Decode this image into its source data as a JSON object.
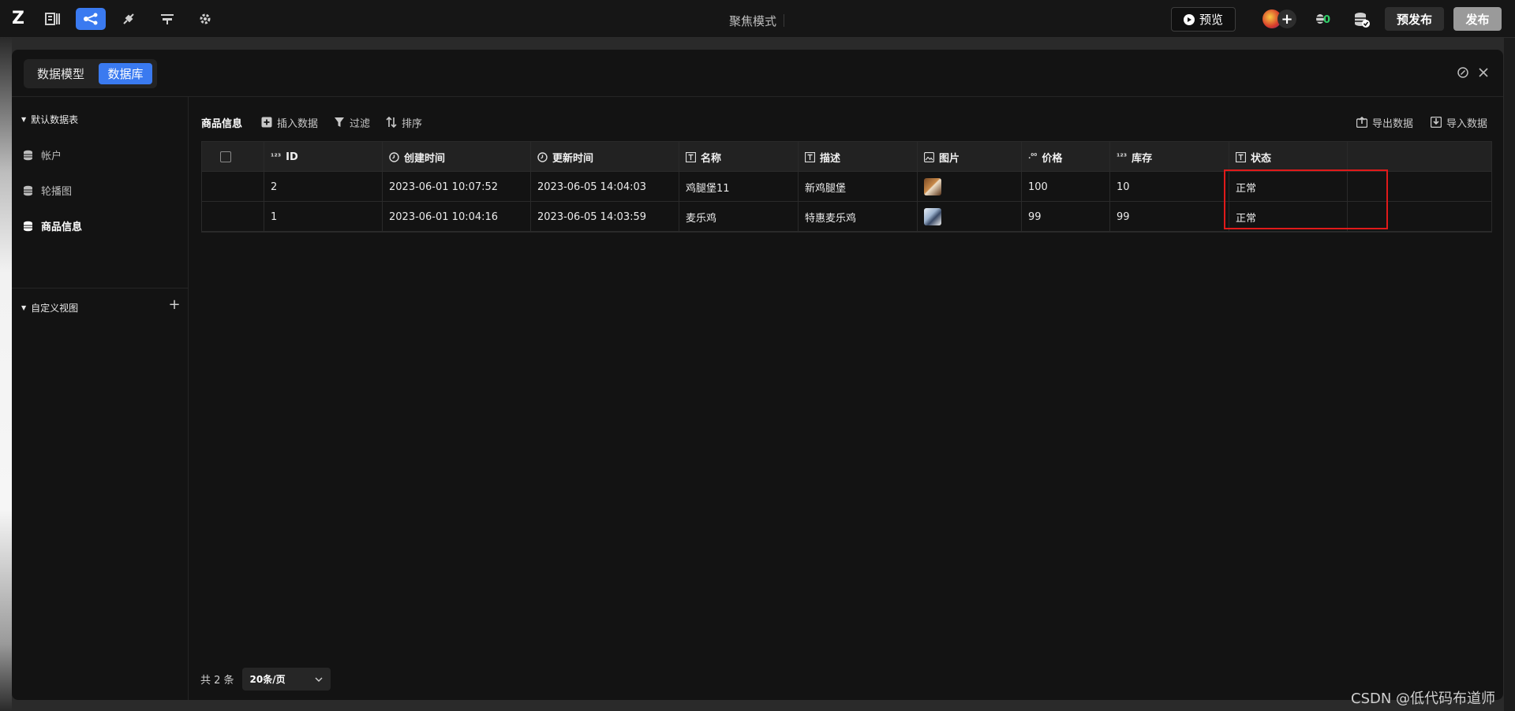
{
  "toolbar": {
    "logo": "Z",
    "focus_mode": "聚焦模式",
    "preview_label": "预览",
    "prepublish_label": "预发布",
    "publish_label": "发布",
    "bug_count": "0"
  },
  "panel": {
    "tabs": [
      {
        "label": "数据模型",
        "active": false
      },
      {
        "label": "数据库",
        "active": true
      }
    ]
  },
  "sidebar": {
    "group_default": "默认数据表",
    "items": [
      {
        "label": "帐户",
        "active": false
      },
      {
        "label": "轮播图",
        "active": false
      },
      {
        "label": "商品信息",
        "active": true
      }
    ],
    "group_custom": "自定义视图"
  },
  "main": {
    "title": "商品信息",
    "insert_label": "插入数据",
    "filter_label": "过滤",
    "sort_label": "排序",
    "export_label": "导出数据",
    "import_label": "导入数据"
  },
  "table": {
    "columns": [
      {
        "label": "ID",
        "icon": "number-icon"
      },
      {
        "label": "创建时间",
        "icon": "clock-icon"
      },
      {
        "label": "更新时间",
        "icon": "clock-icon"
      },
      {
        "label": "名称",
        "icon": "text-icon"
      },
      {
        "label": "描述",
        "icon": "text-icon"
      },
      {
        "label": "图片",
        "icon": "image-icon"
      },
      {
        "label": "价格",
        "icon": "decimal-icon"
      },
      {
        "label": "库存",
        "icon": "number-icon"
      },
      {
        "label": "状态",
        "icon": "text-icon"
      }
    ],
    "rows": [
      {
        "id": "2",
        "created": "2023-06-01 10:07:52",
        "updated": "2023-06-05 14:04:03",
        "name": "鸡腿堡11",
        "desc": "新鸡腿堡",
        "price": "100",
        "stock": "10",
        "status": "正常"
      },
      {
        "id": "1",
        "created": "2023-06-01 10:04:16",
        "updated": "2023-06-05 14:03:59",
        "name": "麦乐鸡",
        "desc": "特惠麦乐鸡",
        "price": "99",
        "stock": "99",
        "status": "正常"
      }
    ]
  },
  "pager": {
    "total": "共 2 条",
    "page_size": "20条/页"
  },
  "watermark": "CSDN @低代码布道师",
  "colors": {
    "accent": "#3a7af0",
    "highlight": "#e01a1a"
  }
}
